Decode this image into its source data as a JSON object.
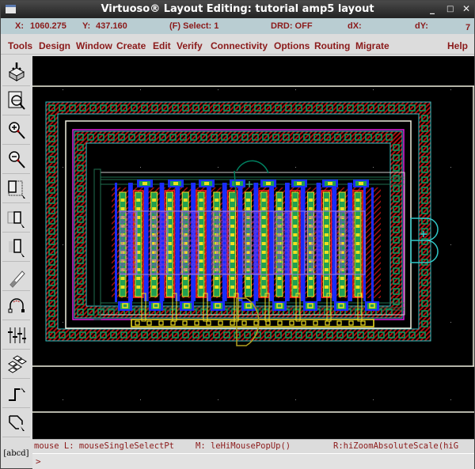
{
  "window": {
    "title": "Virtuoso® Layout Editing: tutorial amp5 layout",
    "controls": {
      "minimize": "_",
      "maximize": "□",
      "close": "✕"
    }
  },
  "status": {
    "x_label": "X:",
    "x_value": "1060.275",
    "y_label": "Y:",
    "y_value": "437.160",
    "select": "(F) Select: 1",
    "drd": "DRD: OFF",
    "dx_label": "dX:",
    "dx_value": "",
    "dy_label": "dY:",
    "dy_value": "",
    "count": "7"
  },
  "menu": {
    "items": [
      "Tools",
      "Design",
      "Window",
      "Create",
      "Edit",
      "Verify",
      "Connectivity",
      "Options",
      "Routing",
      "Migrate"
    ],
    "help": "Help"
  },
  "toolbar": {
    "tools": [
      {
        "name": "save-icon"
      },
      {
        "name": "zoom-fit-icon"
      },
      {
        "name": "zoom-in-icon"
      },
      {
        "name": "zoom-out-icon"
      },
      {
        "name": "stretch-icon"
      },
      {
        "name": "copy-icon"
      },
      {
        "name": "move-icon"
      },
      {
        "name": "delete-icon"
      },
      {
        "name": "undo-icon"
      },
      {
        "name": "properties-icon"
      },
      {
        "name": "create-instance-icon"
      },
      {
        "name": "create-path-icon"
      },
      {
        "name": "create-polygon-icon"
      },
      {
        "name": "create-label-icon"
      }
    ],
    "label_tool_text": "[abcd]"
  },
  "mouse_bindings": {
    "left": "mouse L: mouseSingleSelectPt",
    "middle": "M: leHiMousePopUp()",
    "right": "R:hiZoomAbsoluteScale(hiG"
  },
  "command": {
    "prompt": ">",
    "value": ""
  },
  "layout": {
    "colors": {
      "background": "#000000",
      "guard_ring_fill": "#8b1010",
      "contact": "#00a060",
      "outline_cyan": "#30c8c8",
      "nwell_magenta": "#e020e0",
      "metal1_blue": "#1a2cff",
      "poly_red": "#ff2020",
      "diffusion_green": "#20a050",
      "contact_yellow": "#f0e020",
      "boundary_white": "#f0f0e0",
      "implant_purple": "#8a40e0",
      "selection_circle": "#008060"
    },
    "finger_count": 16
  }
}
